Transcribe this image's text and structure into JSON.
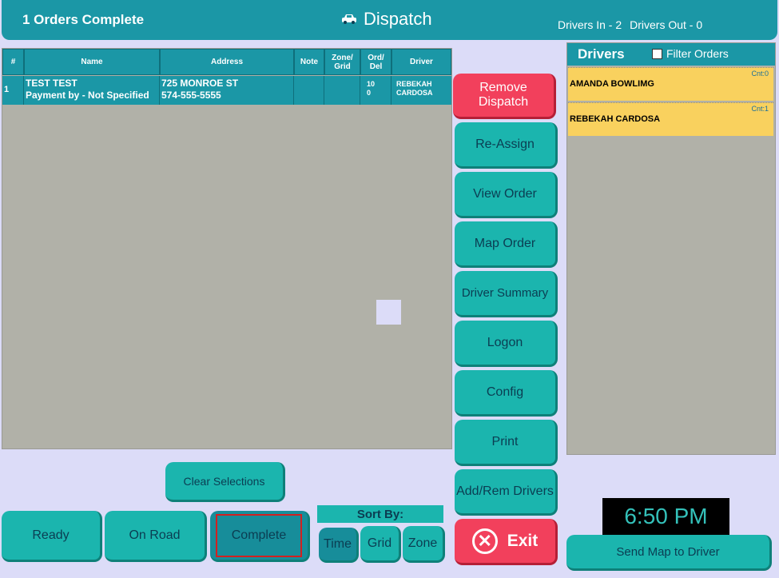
{
  "header": {
    "orders_complete": "1 Orders Complete",
    "title": "Dispatch",
    "drivers_in": "Drivers In - 2",
    "drivers_out": "Drivers Out - 0"
  },
  "orders_table": {
    "columns": [
      "#",
      "Name",
      "Address",
      "Note",
      "Zone/ Grid",
      "Ord/ Del",
      "Driver"
    ],
    "rows": [
      {
        "num": "1",
        "name_line1": "TEST TEST",
        "name_line2": "Payment by - Not Specified",
        "address_line1": "725 MONROE ST",
        "address_line2": "574-555-5555",
        "note": "",
        "zone": "",
        "ord_del_line1": "10",
        "ord_del_line2": "0",
        "driver_line1": "REBEKAH",
        "driver_line2": "CARDOSA"
      }
    ]
  },
  "actions": {
    "remove_dispatch": "Remove Dispatch",
    "reassign": "Re-Assign",
    "view_order": "View Order",
    "map_order": "Map Order",
    "driver_summary": "Driver Summary",
    "logon": "Logon",
    "config": "Config",
    "print": "Print",
    "add_rem_drivers": "Add/Rem Drivers",
    "exit": "Exit"
  },
  "drivers_panel": {
    "title": "Drivers",
    "filter_label": "Filter Orders",
    "drivers": [
      {
        "name": "AMANDA BOWLIMG",
        "count": "Cnt:0"
      },
      {
        "name": "REBEKAH  CARDOSA",
        "count": "Cnt:1"
      }
    ]
  },
  "bottom": {
    "clear_selections": "Clear Selections",
    "ready": "Ready",
    "on_road": "On Road",
    "complete": "Complete",
    "sort_by": "Sort By:",
    "sort_time": "Time",
    "sort_grid": "Grid",
    "sort_zone": "Zone",
    "clock": "6:50 PM",
    "send_map": "Send Map to Driver"
  },
  "colors": {
    "teal_header": "#1b97a6",
    "teal_button": "#1bb5ae",
    "red_button": "#f2405c",
    "driver_card": "#f9d15e",
    "selected_outline": "#d22020"
  },
  "icons": {
    "title_icon": "car-icon",
    "exit_icon": "close-circle-icon"
  }
}
